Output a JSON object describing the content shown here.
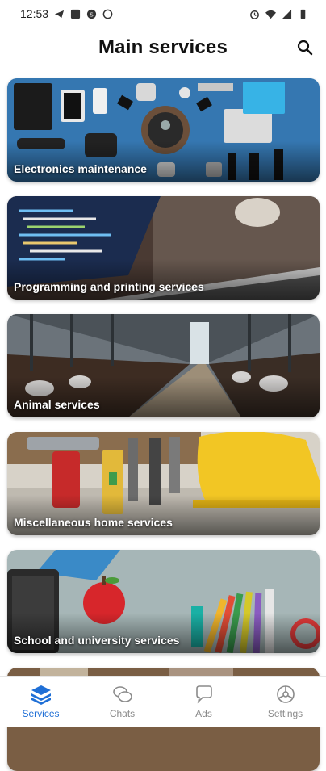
{
  "status_bar": {
    "time": "12:53",
    "left_icons": [
      "telegram-icon",
      "app-icon",
      "s-icon",
      "whatsapp-icon"
    ],
    "right_icons": [
      "alarm-icon",
      "wifi-icon",
      "signal-icon",
      "battery-icon"
    ]
  },
  "header": {
    "title": "Main services",
    "search_icon": "search-icon"
  },
  "services": [
    {
      "label": "Electronics maintenance"
    },
    {
      "label": "Programming and printing services"
    },
    {
      "label": "Animal services"
    },
    {
      "label": "Miscellaneous home services"
    },
    {
      "label": "School and university services"
    }
  ],
  "bottom_nav": {
    "items": [
      {
        "label": "Services",
        "icon": "layers-icon",
        "active": true
      },
      {
        "label": "Chats",
        "icon": "chat-bubbles-icon",
        "active": false
      },
      {
        "label": "Ads",
        "icon": "speech-icon",
        "active": false
      },
      {
        "label": "Settings",
        "icon": "settings-icon",
        "active": false
      }
    ]
  },
  "colors": {
    "accent": "#1f6fd6",
    "inactive": "#8a8a8a"
  }
}
